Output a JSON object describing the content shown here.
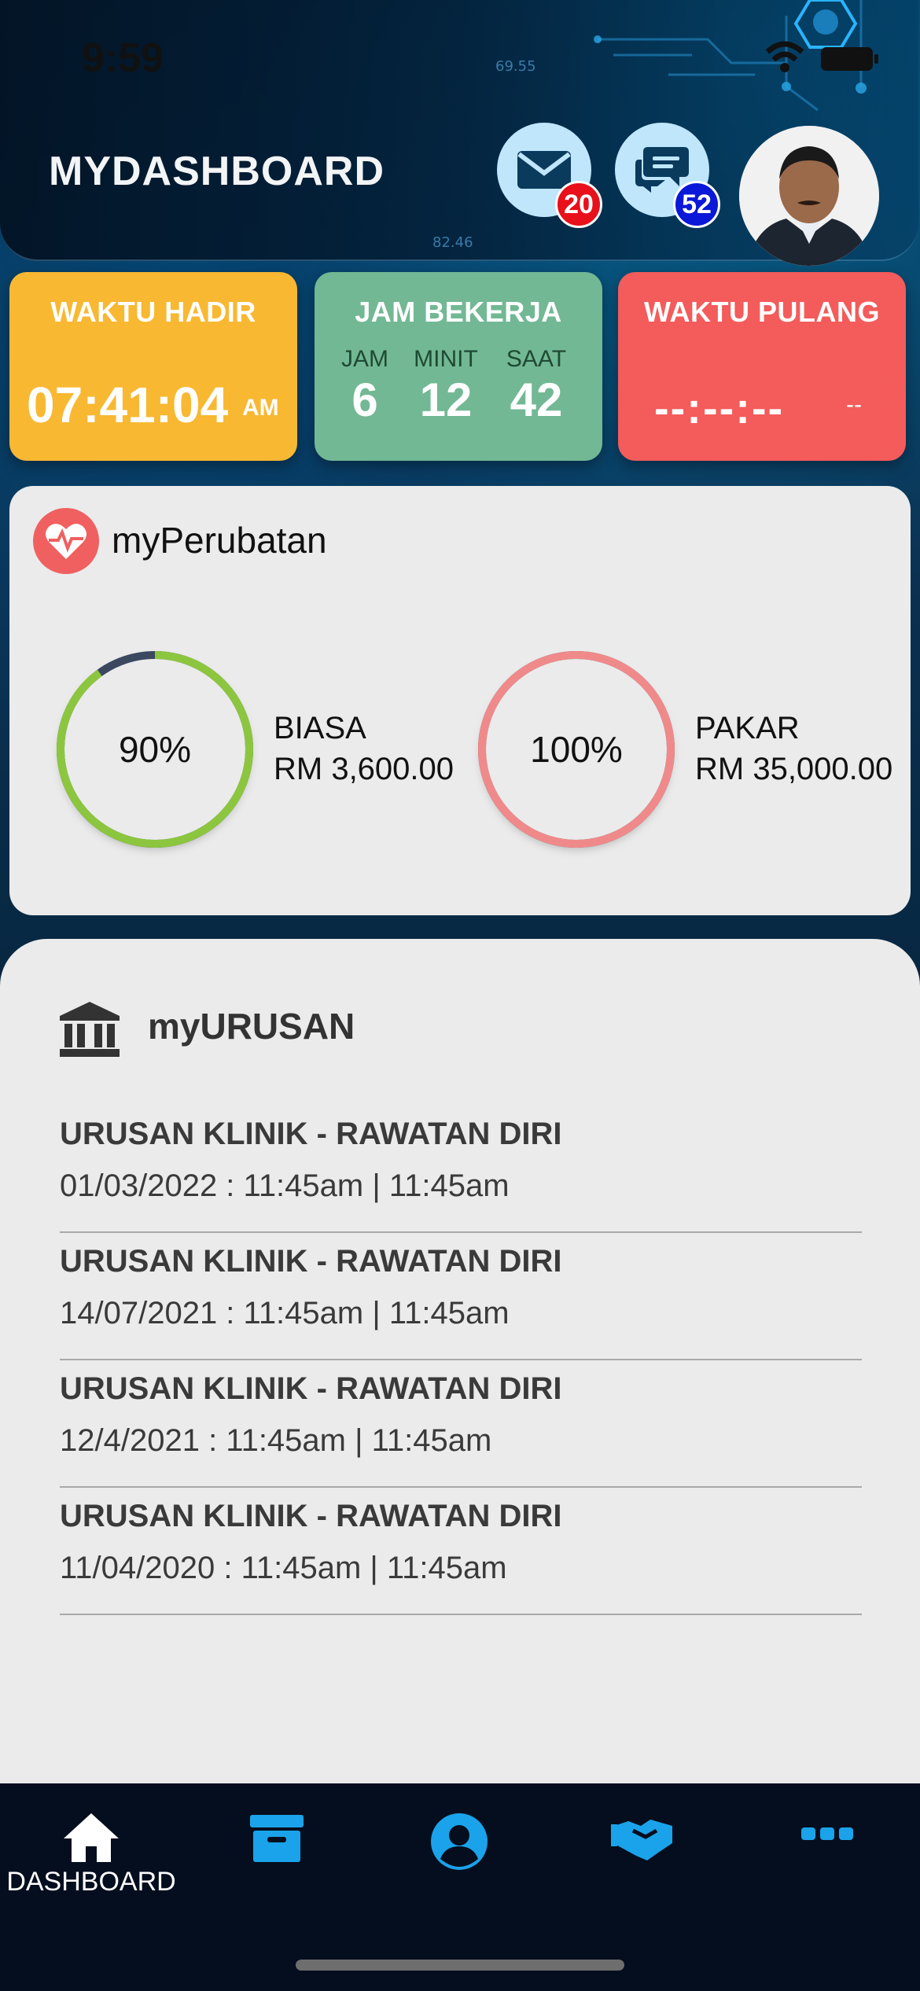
{
  "status_bar": {
    "time": "9:59"
  },
  "header": {
    "title": "MYDASHBOARD",
    "mail_badge": "20",
    "chat_badge": "52",
    "bg_numbers": [
      "69.55",
      "82.46"
    ]
  },
  "attendance": {
    "in": {
      "title": "WAKTU HADIR",
      "time": "07:41:04",
      "ampm": "AM",
      "color": "#f8b832"
    },
    "work": {
      "title": "JAM BEKERJA",
      "labels": [
        "JAM",
        "MINIT",
        "SAAT"
      ],
      "values": [
        "6",
        "12",
        "42"
      ],
      "color": "#72b894"
    },
    "out": {
      "title": "WAKTU PULANG",
      "time": "--:--:--",
      "ampm": "--",
      "color": "#f45b5b"
    }
  },
  "perubatan": {
    "title": "myPerubatan",
    "items": [
      {
        "pct": "90%",
        "fraction": 0.9,
        "type": "BIASA",
        "amount": "RM 3,600.00",
        "color": "#8cc63f"
      },
      {
        "pct": "100%",
        "fraction": 1.0,
        "type": "PAKAR",
        "amount": "RM 35,000.00",
        "color": "#f08a8a"
      }
    ]
  },
  "urusan": {
    "title": "myURUSAN",
    "items": [
      {
        "title": "URUSAN KLINIK - RAWATAN DIRI",
        "detail": "01/03/2022 : 11:45am | 11:45am"
      },
      {
        "title": "URUSAN KLINIK - RAWATAN DIRI",
        "detail": "14/07/2021 : 11:45am | 11:45am"
      },
      {
        "title": "URUSAN KLINIK - RAWATAN DIRI",
        "detail": "12/4/2021 : 11:45am | 11:45am"
      },
      {
        "title": "URUSAN KLINIK - RAWATAN DIRI",
        "detail": "11/04/2020 : 11:45am | 11:45am"
      }
    ]
  },
  "tabbar": {
    "items": [
      {
        "icon": "home-icon",
        "label": "DASHBOARD",
        "active": true
      },
      {
        "icon": "archive-icon",
        "label": ""
      },
      {
        "icon": "user-icon",
        "label": ""
      },
      {
        "icon": "handshake-icon",
        "label": ""
      },
      {
        "icon": "more-icon",
        "label": ""
      }
    ],
    "accent": "#1aa3ea"
  }
}
